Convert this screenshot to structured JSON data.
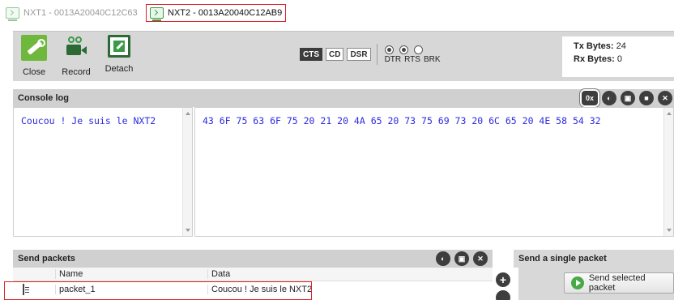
{
  "tabs": [
    {
      "label": "NXT1 - 0013A20040C12C63",
      "active": false
    },
    {
      "label": "NXT2 - 0013A20040C12AB9",
      "active": true
    }
  ],
  "toolbar": {
    "close_label": "Close",
    "record_label": "Record",
    "detach_label": "Detach",
    "lines": [
      "CTS",
      "CD",
      "DSR"
    ],
    "radio_labels": [
      "DTR",
      "RTS",
      "BRK"
    ],
    "radio_states": [
      true,
      true,
      false
    ]
  },
  "stats": {
    "tx_label": "Tx Bytes:",
    "tx_value": "24",
    "rx_label": "Rx Bytes:",
    "rx_value": "0"
  },
  "console": {
    "title": "Console log",
    "hex_button": "0x",
    "ascii_text": "Coucou ! Je suis le NXT2",
    "hex_text": "43 6F 75 63 6F 75 20 21 20 4A 65 20 73 75 69 73 20 6C 65 20 4E 58 54 32"
  },
  "send_packets": {
    "title": "Send packets",
    "columns": [
      "Name",
      "Data"
    ],
    "rows": [
      {
        "name": "packet_1",
        "data": "Coucou ! Je suis le NXT2"
      }
    ]
  },
  "single_packet": {
    "title": "Send a single packet",
    "button_label": "Send selected packet"
  }
}
